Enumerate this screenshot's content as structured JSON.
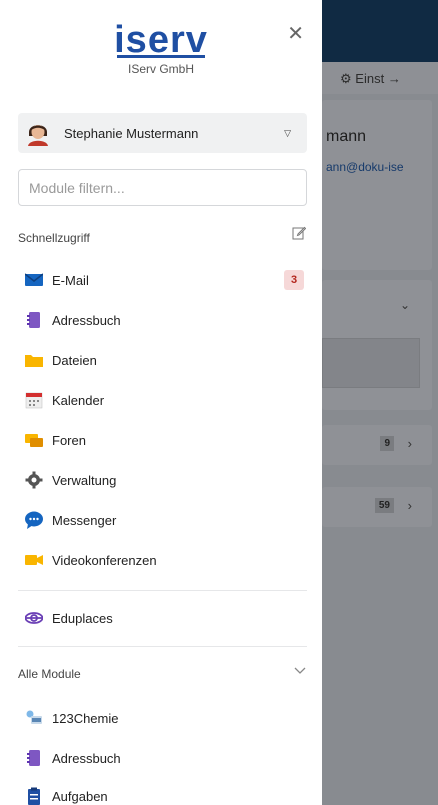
{
  "brand": {
    "logo_text": "iserv",
    "company": "IServ GmbH",
    "logo_color": "#1f4fa3"
  },
  "close_icon": "close-icon",
  "user": {
    "name": "Stephanie Mustermann"
  },
  "filter": {
    "placeholder": "Module filtern..."
  },
  "quick_access": {
    "title": "Schnellzugriff",
    "items": [
      {
        "label": "E-Mail",
        "icon": "mail-icon",
        "badge": "3"
      },
      {
        "label": "Adressbuch",
        "icon": "addressbook-icon"
      },
      {
        "label": "Dateien",
        "icon": "folder-icon"
      },
      {
        "label": "Kalender",
        "icon": "calendar-icon"
      },
      {
        "label": "Foren",
        "icon": "forum-icon"
      },
      {
        "label": "Verwaltung",
        "icon": "gear-icon"
      },
      {
        "label": "Messenger",
        "icon": "chat-bubble-icon"
      },
      {
        "label": "Videokonferenzen",
        "icon": "video-camera-icon"
      }
    ]
  },
  "eduplaces": {
    "label": "Eduplaces",
    "icon": "eduplaces-icon"
  },
  "all_modules": {
    "title": "Alle Module",
    "items": [
      {
        "label": "123Chemie",
        "icon": "chemie-icon"
      },
      {
        "label": "Adressbuch",
        "icon": "addressbook-icon"
      },
      {
        "label": "Aufgaben",
        "icon": "tasks-icon"
      }
    ]
  },
  "background": {
    "toolbar_text": "Einst",
    "card_name": "mann",
    "card_email": "ann@doku-ise",
    "row_counts": [
      "9",
      "59"
    ]
  }
}
